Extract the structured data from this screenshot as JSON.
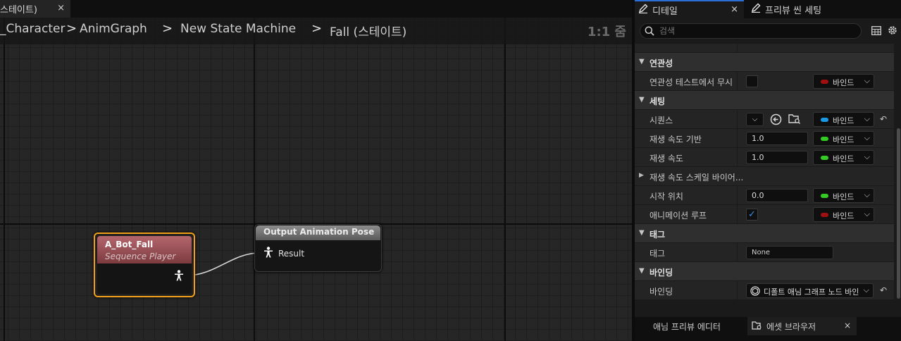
{
  "graph": {
    "tab_label": "스테이트)",
    "tab_close": "×",
    "breadcrumb": [
      "_Character",
      "AnimGraph",
      "New State Machine",
      "Fall (스테이트)"
    ],
    "breadcrumb_sep": ">",
    "zoom": "1:1 줌",
    "nodes": {
      "sequence_player": {
        "title": "A_Bot_Fall",
        "subtitle": "Sequence Player"
      },
      "output_pose": {
        "title": "Output Animation Pose",
        "pin_label": "Result"
      }
    }
  },
  "details": {
    "tabs": [
      {
        "label": "디테일",
        "close": "×"
      },
      {
        "label": "프리뷰 씬 세팅"
      }
    ],
    "search_placeholder": "검색",
    "categories": {
      "relevancy": "연관성",
      "settings": "세팅",
      "tags": "태그",
      "binding": "바인딩"
    },
    "properties": {
      "ignore_relevancy": {
        "label": "연관성 테스트에서 무시",
        "checked": false,
        "bind": "바인드",
        "dot_color": "#a01010"
      },
      "sequence": {
        "label": "시퀀스",
        "bind": "바인드",
        "dot_color": "#1a9ae6"
      },
      "play_rate_basis": {
        "label": "재생 속도 기반",
        "value": "1.0",
        "bind": "바인드",
        "dot_color": "#33cc22"
      },
      "play_rate": {
        "label": "재생 속도",
        "value": "1.0",
        "bind": "바인드",
        "dot_color": "#33cc22"
      },
      "play_rate_scale_bias": {
        "label": "재생 속도 스케일 바이어..."
      },
      "start_position": {
        "label": "시작 위치",
        "value": "0.0",
        "bind": "바인드",
        "dot_color": "#33cc22"
      },
      "loop_animation": {
        "label": "애니메이션 루프",
        "checked": true,
        "bind": "바인드",
        "dot_color": "#a01010"
      },
      "tag": {
        "label": "태그",
        "value": "None"
      },
      "binding": {
        "label": "바인딩",
        "value": "디폴트 애님 그래프 노드 바인딩"
      }
    },
    "chevron": "⌵",
    "reset_icon": "↶"
  },
  "bottom_tabs": [
    {
      "label": "애님 프리뷰 에디터"
    },
    {
      "label": "에셋 브라우저",
      "close": "×"
    }
  ]
}
